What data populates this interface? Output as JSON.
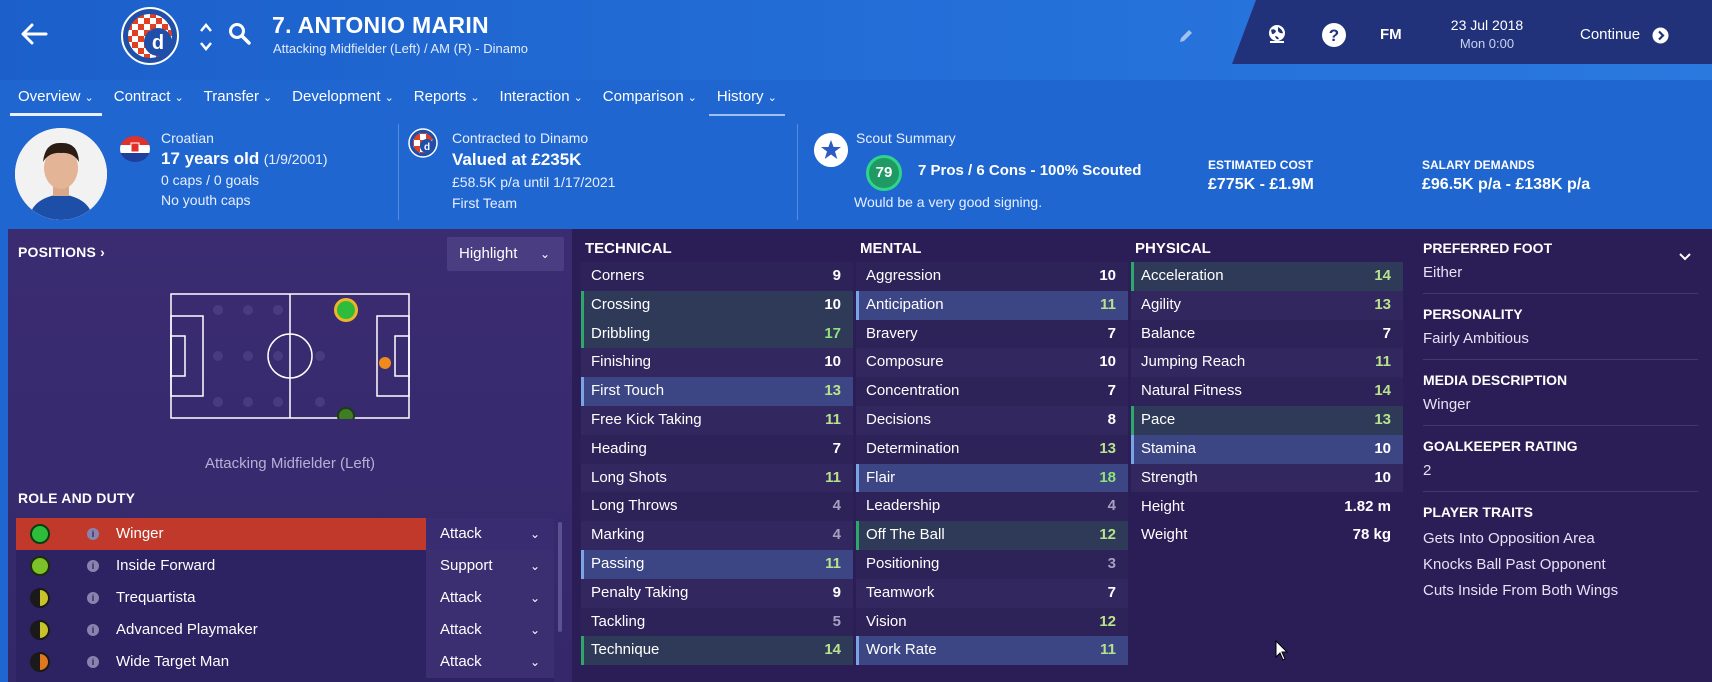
{
  "header": {
    "player_name": "7. ANTONIO MARIN",
    "player_subtitle": "Attacking Midfielder (Left) / AM (R) - Dinamo",
    "date": "23 Jul 2018",
    "time": "Mon 0:00",
    "fm_logo": "FM",
    "continue_label": "Continue"
  },
  "tabs": [
    {
      "label": "Overview"
    },
    {
      "label": "Contract"
    },
    {
      "label": "Transfer"
    },
    {
      "label": "Development"
    },
    {
      "label": "Reports"
    },
    {
      "label": "Interaction"
    },
    {
      "label": "Comparison"
    },
    {
      "label": "History"
    }
  ],
  "profile": {
    "nationality": "Croatian",
    "age": "17 years old",
    "dob": "(1/9/2001)",
    "caps": "0 caps / 0 goals",
    "youth_caps": "No youth caps"
  },
  "contract": {
    "contracted_to": "Contracted to Dinamo",
    "value": "Valued at £235K",
    "wage": "£58.5K p/a until 1/17/2021",
    "squad": "First Team"
  },
  "scout": {
    "title": "Scout Summary",
    "rating": "79",
    "summary": "7 Pros / 6 Cons - 100% Scouted",
    "verdict": "Would be a very good signing.",
    "estimated_cost_label": "ESTIMATED COST",
    "estimated_cost": "£775K - £1.9M",
    "salary_label": "SALARY DEMANDS",
    "salary": "£96.5K p/a - £138K p/a"
  },
  "positions": {
    "title": "POSITIONS",
    "highlight_label": "Highlight",
    "caption": "Attacking Midfielder (Left)"
  },
  "roles": {
    "title": "ROLE AND DUTY",
    "items": [
      {
        "name": "Winger",
        "duty": "Attack",
        "color": "#2ebd3a"
      },
      {
        "name": "Inside Forward",
        "duty": "Support",
        "color": "#7cc02a"
      },
      {
        "name": "Trequartista",
        "duty": "Attack",
        "color": "#c9c22a"
      },
      {
        "name": "Advanced Playmaker",
        "duty": "Attack",
        "color": "#c9c22a"
      },
      {
        "name": "Wide Target Man",
        "duty": "Attack",
        "color": "#e0781e"
      }
    ]
  },
  "attributes": {
    "technical_title": "TECHNICAL",
    "technical": [
      {
        "name": "Corners",
        "value": "9"
      },
      {
        "name": "Crossing",
        "value": "10"
      },
      {
        "name": "Dribbling",
        "value": "17"
      },
      {
        "name": "Finishing",
        "value": "10"
      },
      {
        "name": "First Touch",
        "value": "13"
      },
      {
        "name": "Free Kick Taking",
        "value": "11"
      },
      {
        "name": "Heading",
        "value": "7"
      },
      {
        "name": "Long Shots",
        "value": "11"
      },
      {
        "name": "Long Throws",
        "value": "4"
      },
      {
        "name": "Marking",
        "value": "4"
      },
      {
        "name": "Passing",
        "value": "11"
      },
      {
        "name": "Penalty Taking",
        "value": "9"
      },
      {
        "name": "Tackling",
        "value": "5"
      },
      {
        "name": "Technique",
        "value": "14"
      }
    ],
    "mental_title": "MENTAL",
    "mental": [
      {
        "name": "Aggression",
        "value": "10"
      },
      {
        "name": "Anticipation",
        "value": "11"
      },
      {
        "name": "Bravery",
        "value": "7"
      },
      {
        "name": "Composure",
        "value": "10"
      },
      {
        "name": "Concentration",
        "value": "7"
      },
      {
        "name": "Decisions",
        "value": "8"
      },
      {
        "name": "Determination",
        "value": "13"
      },
      {
        "name": "Flair",
        "value": "18"
      },
      {
        "name": "Leadership",
        "value": "4"
      },
      {
        "name": "Off The Ball",
        "value": "12"
      },
      {
        "name": "Positioning",
        "value": "3"
      },
      {
        "name": "Teamwork",
        "value": "7"
      },
      {
        "name": "Vision",
        "value": "12"
      },
      {
        "name": "Work Rate",
        "value": "11"
      }
    ],
    "physical_title": "PHYSICAL",
    "physical": [
      {
        "name": "Acceleration",
        "value": "14"
      },
      {
        "name": "Agility",
        "value": "13"
      },
      {
        "name": "Balance",
        "value": "7"
      },
      {
        "name": "Jumping Reach",
        "value": "11"
      },
      {
        "name": "Natural Fitness",
        "value": "14"
      },
      {
        "name": "Pace",
        "value": "13"
      },
      {
        "name": "Stamina",
        "value": "10"
      },
      {
        "name": "Strength",
        "value": "10"
      }
    ],
    "height_label": "Height",
    "height": "1.82 m",
    "weight_label": "Weight",
    "weight": "78 kg"
  },
  "details": {
    "preferred_foot_label": "PREFERRED FOOT",
    "preferred_foot": "Either",
    "personality_label": "PERSONALITY",
    "personality": "Fairly Ambitious",
    "media_label": "MEDIA DESCRIPTION",
    "media": "Winger",
    "gk_label": "GOALKEEPER RATING",
    "gk": "2",
    "traits_label": "PLAYER TRAITS",
    "traits": [
      "Gets Into Opposition Area",
      "Knocks Ball Past Opponent",
      "Cuts Inside From Both Wings"
    ]
  }
}
